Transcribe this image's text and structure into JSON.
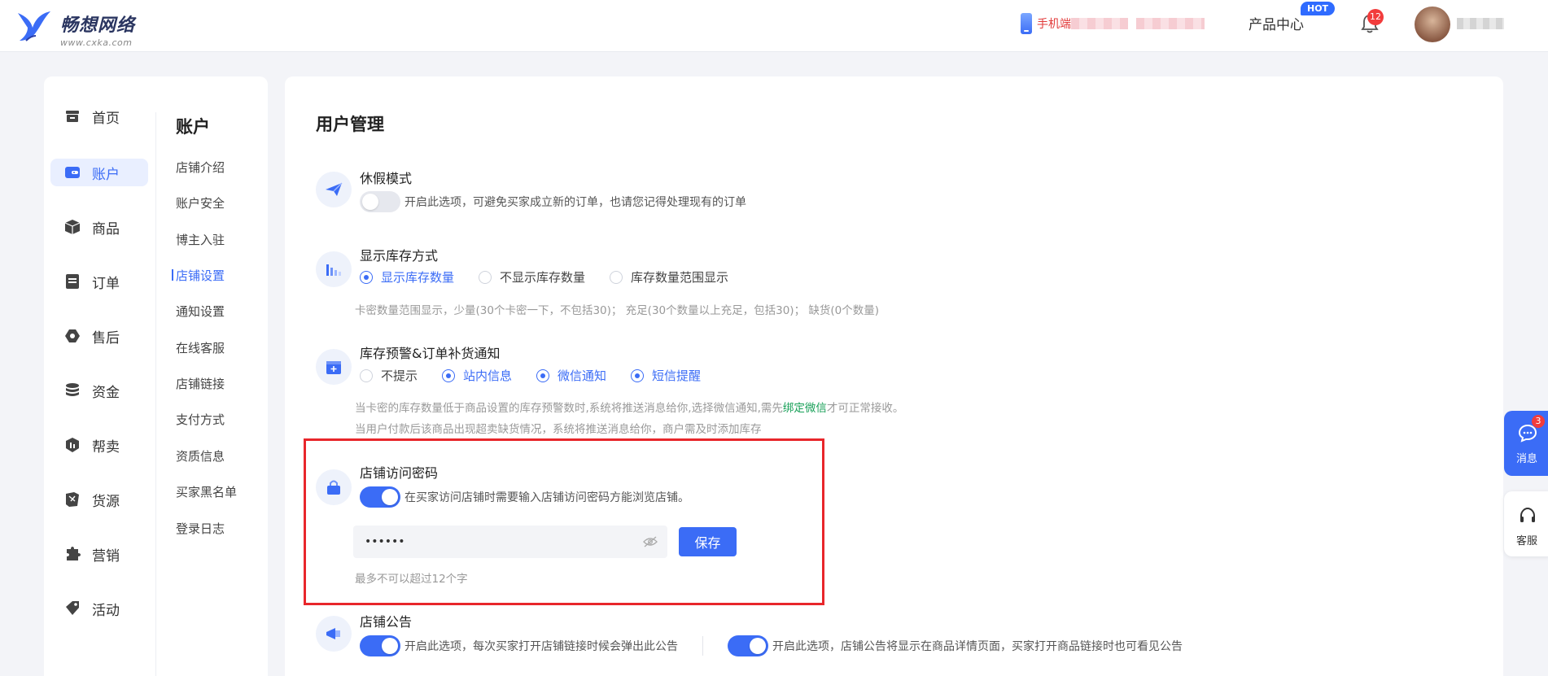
{
  "colors": {
    "accent": "#3b6cf6",
    "highlight": "#e8262b",
    "badge": "#f23c3c",
    "link_green": "#18a058"
  },
  "header": {
    "brand_title": "畅想网络",
    "brand_url": "www.cxka.com",
    "mobile_label": "手机端",
    "product_center": "产品中心",
    "hot_badge": "HOT",
    "notification_count": "12"
  },
  "nav": {
    "items": [
      {
        "label": "首页",
        "icon": "store-icon"
      },
      {
        "label": "账户",
        "icon": "wallet-icon",
        "active": true
      },
      {
        "label": "商品",
        "icon": "box-icon"
      },
      {
        "label": "订单",
        "icon": "order-icon"
      },
      {
        "label": "售后",
        "icon": "aftersale-icon"
      },
      {
        "label": "资金",
        "icon": "coins-icon"
      },
      {
        "label": "帮卖",
        "icon": "helpsell-icon"
      },
      {
        "label": "货源",
        "icon": "source-icon"
      },
      {
        "label": "营销",
        "icon": "puzzle-icon"
      },
      {
        "label": "活动",
        "icon": "tag-icon"
      }
    ]
  },
  "subnav": {
    "title": "账户",
    "items": [
      "店铺介绍",
      "账户安全",
      "博主入驻",
      "店铺设置",
      "通知设置",
      "在线客服",
      "店铺链接",
      "支付方式",
      "资质信息",
      "买家黑名单",
      "登录日志"
    ],
    "active_index": 3
  },
  "main": {
    "page_title": "用户管理",
    "vacation": {
      "title": "休假模式",
      "enabled": false,
      "desc": "开启此选项，可避免买家成立新的订单，也请您记得处理现有的订单"
    },
    "stock_display": {
      "title": "显示库存方式",
      "options": [
        "显示库存数量",
        "不显示库存数量",
        "库存数量范围显示"
      ],
      "selected": "显示库存数量",
      "hint": "卡密数量范围显示，少量(30个卡密一下，不包括30)；  充足(30个数量以上充足，包括30)；  缺货(0个数量)"
    },
    "stock_alert": {
      "title": "库存预警&订单补货通知",
      "options": [
        "不提示",
        "站内信息",
        "微信通知",
        "短信提醒"
      ],
      "checked": [
        "站内信息",
        "微信通知",
        "短信提醒"
      ],
      "hint1_a": "当卡密的库存数量低于商品设置的库存预警数时,系统将推送消息给你,选择微信通知,需先",
      "hint1_link": "绑定微信",
      "hint1_b": "才可正常接收。",
      "hint2": "当用户付款后该商品出现超卖缺货情况，系统将推送消息给你，商户需及时添加库存"
    },
    "store_password": {
      "title": "店铺访问密码",
      "enabled": true,
      "desc": "在买家访问店铺时需要输入店铺访问密码方能浏览店铺。",
      "password_value": "••••••",
      "save_label": "保存",
      "hint": "最多不可以超过12个字"
    },
    "announcement": {
      "title": "店铺公告",
      "enabled_popup": true,
      "desc_popup": "开启此选项，每次买家打开店铺链接时候会弹出此公告",
      "enabled_detail": true,
      "desc_detail": "开启此选项，店铺公告将显示在商品详情页面，买家打开商品链接时也可看见公告"
    }
  },
  "floating": {
    "message_label": "消息",
    "message_count": "3",
    "service_label": "客服"
  }
}
